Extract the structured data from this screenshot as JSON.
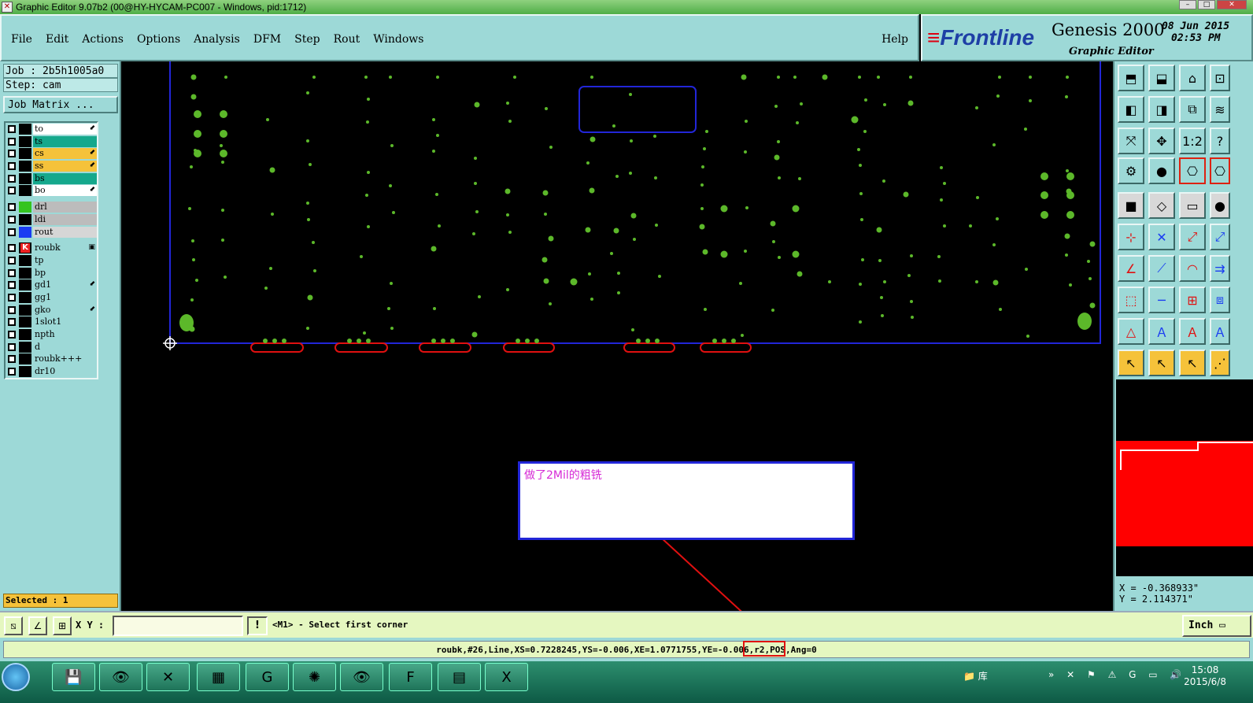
{
  "window": {
    "title": "Graphic Editor 9.07b2 (00@HY-HYCAM-PC007 - Windows, pid:1712)"
  },
  "menu": {
    "items": [
      "File",
      "Edit",
      "Actions",
      "Options",
      "Analysis",
      "DFM",
      "Step",
      "Rout",
      "Windows"
    ],
    "help": "Help"
  },
  "brand": {
    "logo": "Frontline",
    "product": "Genesis 2000",
    "subtitle": "Graphic Editor",
    "date_line1": "08 Jun 2015",
    "date_line2": "02:53 PM"
  },
  "job": {
    "job_line": "Job : 2b5h1005a0",
    "step_line": "Step: cam",
    "matrix_button": "Job Matrix ..."
  },
  "layers": [
    {
      "name": "to",
      "color": "#ffffff",
      "group": 1,
      "arrow": true
    },
    {
      "name": "ts",
      "color": "#15a88c",
      "group": 1,
      "arrow": false
    },
    {
      "name": "cs",
      "color": "#f5c23a",
      "group": 1,
      "arrow": true
    },
    {
      "name": "ss",
      "color": "#f5c23a",
      "group": 1,
      "arrow": true
    },
    {
      "name": "bs",
      "color": "#15a88c",
      "group": 1,
      "arrow": false
    },
    {
      "name": "bo",
      "color": "#ffffff",
      "group": 1,
      "arrow": true
    },
    {
      "name": "drl",
      "color": "#bcbcbc",
      "group": 2,
      "arrow": false,
      "swatch": "#34c41f"
    },
    {
      "name": "ldi",
      "color": "#bcbcbc",
      "group": 2,
      "arrow": false
    },
    {
      "name": "rout",
      "color": "#d6d6d6",
      "group": 2,
      "arrow": false,
      "swatch": "#1a3cf2"
    },
    {
      "name": "roubk",
      "color": "#9dd9d7",
      "group": 3,
      "arrow": false,
      "swatch": "#ffffff",
      "work": true
    },
    {
      "name": "tp",
      "color": "#9dd9d7",
      "group": 3,
      "arrow": false
    },
    {
      "name": "bp",
      "color": "#9dd9d7",
      "group": 3,
      "arrow": false
    },
    {
      "name": "gd1",
      "color": "#9dd9d7",
      "group": 3,
      "arrow": true
    },
    {
      "name": "gg1",
      "color": "#9dd9d7",
      "group": 3,
      "arrow": false
    },
    {
      "name": "gko",
      "color": "#9dd9d7",
      "group": 3,
      "arrow": true
    },
    {
      "name": "1slot1",
      "color": "#9dd9d7",
      "group": 3,
      "arrow": false
    },
    {
      "name": "npth",
      "color": "#9dd9d7",
      "group": 3,
      "arrow": false
    },
    {
      "name": "d",
      "color": "#9dd9d7",
      "group": 3,
      "arrow": false
    },
    {
      "name": "roubk+++",
      "color": "#9dd9d7",
      "group": 3,
      "arrow": false
    },
    {
      "name": "dr10",
      "color": "#9dd9d7",
      "group": 3,
      "arrow": false
    }
  ],
  "selected": "Selected : 1",
  "annotation": {
    "text": "做了2Mil的粗铣"
  },
  "coords": {
    "x": "X = -0.368933\"",
    "y": "Y =  2.114371\""
  },
  "command": {
    "xy_label": "X Y :",
    "xy_value": "",
    "prompt": "<M1> - Select first corner",
    "units": "Inch"
  },
  "status": {
    "text": "roubk,#26,Line,XS=0.7228245,YS=-0.006,XE=1.0771755,YE=-0.006,r2,POS,Ang=0"
  },
  "taskbar": {
    "tray_library": "库",
    "time": "15:08",
    "date": "2015/6/8"
  },
  "colors": {
    "panel": "#9dd9d7",
    "pad_green": "#5cb82a",
    "outline_blue": "#2226d8",
    "highlight_red": "#e01010"
  }
}
